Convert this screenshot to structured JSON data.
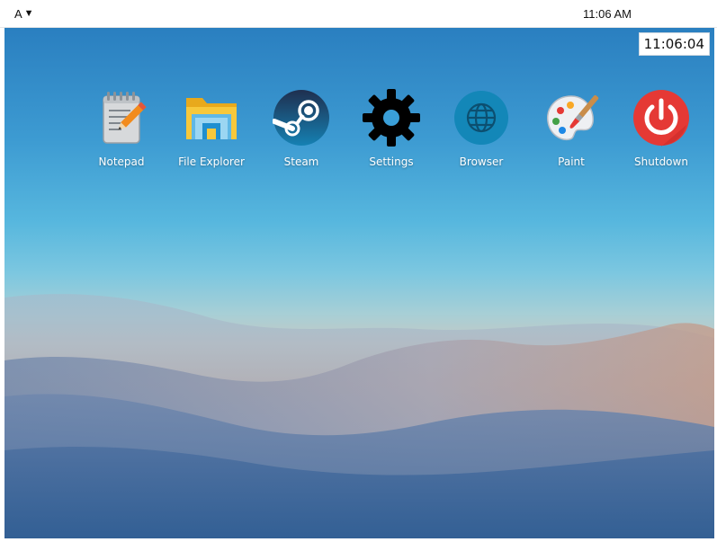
{
  "topbar": {
    "indicator_letter": "A",
    "indicator_caret": "▼",
    "time": "11:06 AM"
  },
  "desktop": {
    "clock": "11:06:04",
    "icons": [
      {
        "label": "Notepad",
        "icon": "notepad-icon"
      },
      {
        "label": "File Explorer",
        "icon": "folder-icon"
      },
      {
        "label": "Steam",
        "icon": "steam-icon"
      },
      {
        "label": "Settings",
        "icon": "gear-icon"
      },
      {
        "label": "Browser",
        "icon": "globe-icon"
      },
      {
        "label": "Paint",
        "icon": "palette-icon"
      },
      {
        "label": "Shutdown",
        "icon": "power-icon"
      }
    ]
  },
  "colors": {
    "shutdown_red": "#e53935",
    "steam_navy": "#1b2a44",
    "browser_blue": "#1387b8",
    "folder_yellow": "#f7c83b"
  }
}
